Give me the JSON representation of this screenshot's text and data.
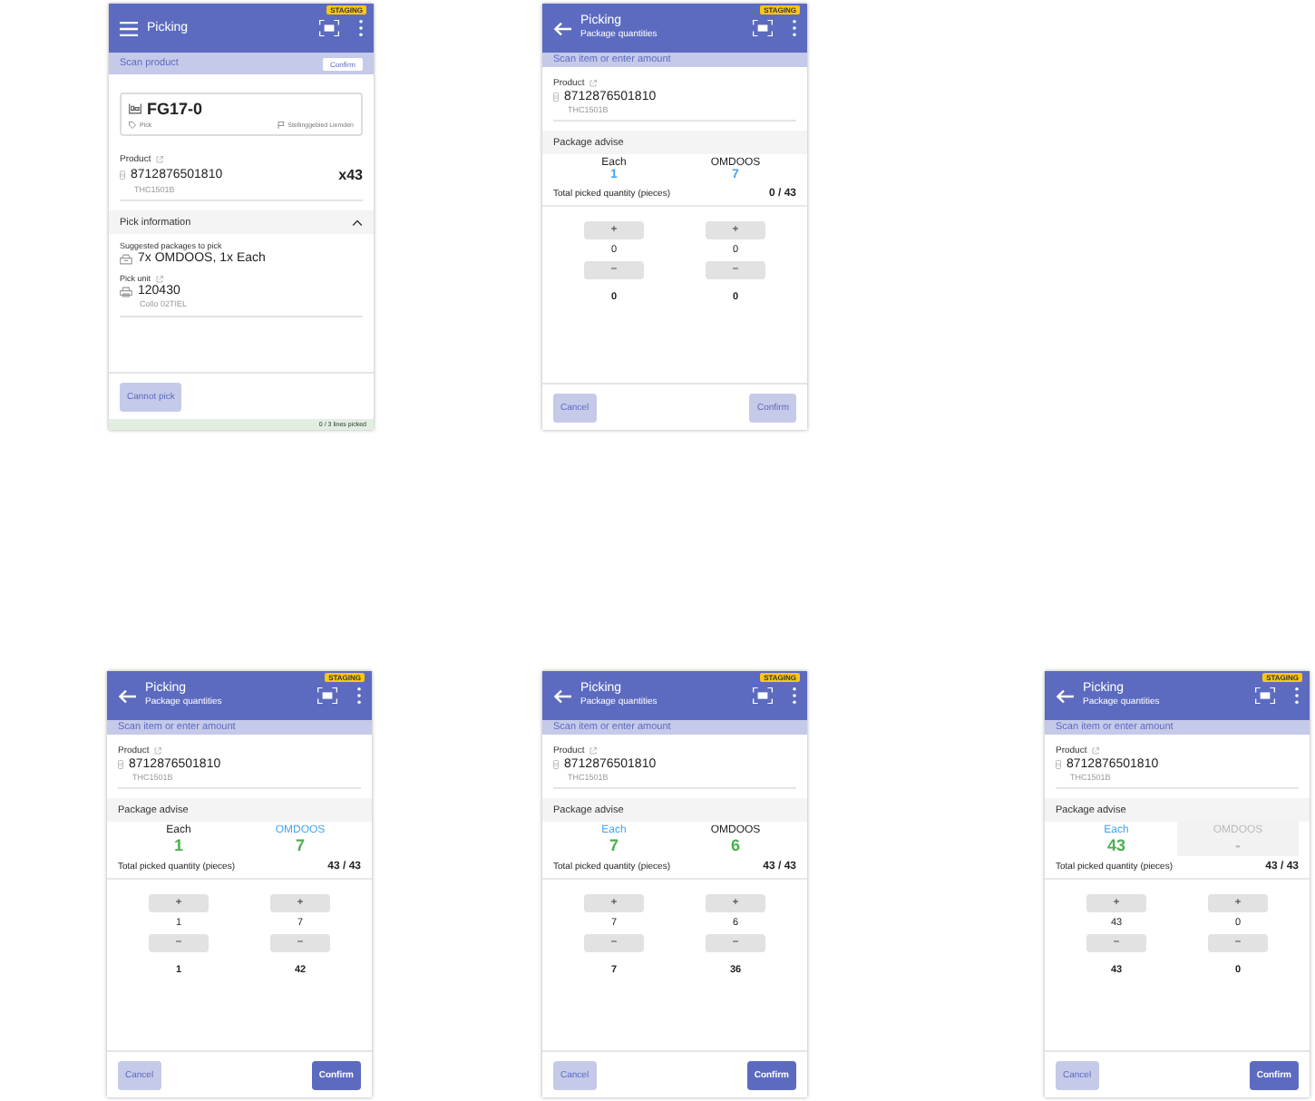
{
  "screens": [
    {
      "kind": "scan_product",
      "header": {
        "title": "Picking",
        "badge": "STAGING"
      },
      "scan_bar": {
        "label": "Scan product",
        "button": "Confirm"
      },
      "location": {
        "code": "FG17-0",
        "type": "Pick",
        "area": "Stellinggebied Liemden"
      },
      "product": {
        "label": "Product",
        "barcode": "8712876501810",
        "code": "THC1501B",
        "quantity": "x43"
      },
      "pick_information": {
        "title": "Pick information",
        "expanded": true,
        "suggested_label": "Suggested packages to pick",
        "suggested": "7x OMDOOS, 1x Each",
        "pick_unit_label": "Pick unit",
        "pick_unit": "120430",
        "pick_unit_name": "Collo 02TIEL"
      },
      "footer": {
        "button": "Cannot pick"
      },
      "status": {
        "text": "0 / 3 lines picked",
        "level": 0
      }
    },
    {
      "kind": "package_quantities",
      "header": {
        "title": "Picking",
        "subtitle": "Package quantities",
        "badge": "STAGING"
      },
      "scan_bar": {
        "label": "Scan item or enter amount"
      },
      "product": {
        "label": "Product",
        "barcode": "8712876501810",
        "code": "THC1501B"
      },
      "advise": {
        "title": "Package advise",
        "complete": false,
        "columns": [
          {
            "name": "Each",
            "value": "1",
            "selected": false,
            "disabled": false
          },
          {
            "name": "OMDOOS",
            "value": "7",
            "selected": false,
            "disabled": false
          }
        ]
      },
      "total": {
        "label": "Total picked quantity (pieces)",
        "value": "0 / 43"
      },
      "steppers": [
        {
          "plus": "+",
          "count": "0",
          "minus": "−",
          "subtotal": "0"
        },
        {
          "plus": "+",
          "count": "0",
          "minus": "−",
          "subtotal": "0"
        }
      ],
      "buttons": {
        "cancel": "Cancel",
        "confirm": "Confirm",
        "confirm_disabled": true
      }
    },
    {
      "kind": "package_quantities",
      "header": {
        "title": "Picking",
        "subtitle": "Package quantities",
        "badge": "STAGING"
      },
      "scan_bar": {
        "label": "Scan item or enter amount"
      },
      "product": {
        "label": "Product",
        "barcode": "8712876501810",
        "code": "THC1501B"
      },
      "advise": {
        "title": "Package advise",
        "complete": true,
        "columns": [
          {
            "name": "Each",
            "value": "1",
            "selected": false,
            "disabled": false
          },
          {
            "name": "OMDOOS",
            "value": "7",
            "selected": true,
            "disabled": false
          }
        ]
      },
      "total": {
        "label": "Total picked quantity (pieces)",
        "value": "43 / 43"
      },
      "steppers": [
        {
          "plus": "+",
          "count": "1",
          "minus": "−",
          "subtotal": "1"
        },
        {
          "plus": "+",
          "count": "7",
          "minus": "−",
          "subtotal": "42"
        }
      ],
      "buttons": {
        "cancel": "Cancel",
        "confirm": "Confirm",
        "confirm_disabled": false
      }
    },
    {
      "kind": "package_quantities",
      "header": {
        "title": "Picking",
        "subtitle": "Package quantities",
        "badge": "STAGING"
      },
      "scan_bar": {
        "label": "Scan item or enter amount"
      },
      "product": {
        "label": "Product",
        "barcode": "8712876501810",
        "code": "THC1501B"
      },
      "advise": {
        "title": "Package advise",
        "complete": true,
        "columns": [
          {
            "name": "Each",
            "value": "7",
            "selected": true,
            "disabled": false
          },
          {
            "name": "OMDOOS",
            "value": "6",
            "selected": false,
            "disabled": false
          }
        ]
      },
      "total": {
        "label": "Total picked quantity (pieces)",
        "value": "43 / 43"
      },
      "steppers": [
        {
          "plus": "+",
          "count": "7",
          "minus": "−",
          "subtotal": "7"
        },
        {
          "plus": "+",
          "count": "6",
          "minus": "−",
          "subtotal": "36"
        }
      ],
      "buttons": {
        "cancel": "Cancel",
        "confirm": "Confirm",
        "confirm_disabled": false
      }
    },
    {
      "kind": "package_quantities",
      "header": {
        "title": "Picking",
        "subtitle": "Package quantities",
        "badge": "STAGING"
      },
      "scan_bar": {
        "label": "Scan item or enter amount"
      },
      "product": {
        "label": "Product",
        "barcode": "8712876501810",
        "code": "THC1501B"
      },
      "advise": {
        "title": "Package advise",
        "complete": true,
        "columns": [
          {
            "name": "Each",
            "value": "43",
            "selected": true,
            "disabled": false
          },
          {
            "name": "OMDOOS",
            "value": "-",
            "selected": false,
            "disabled": true
          }
        ]
      },
      "total": {
        "label": "Total picked quantity (pieces)",
        "value": "43 / 43"
      },
      "steppers": [
        {
          "plus": "+",
          "count": "43",
          "minus": "−",
          "subtotal": "43"
        },
        {
          "plus": "+",
          "count": "0",
          "minus": "−",
          "subtotal": "0"
        }
      ],
      "buttons": {
        "cancel": "Cancel",
        "confirm": "Confirm",
        "confirm_disabled": false
      }
    }
  ]
}
